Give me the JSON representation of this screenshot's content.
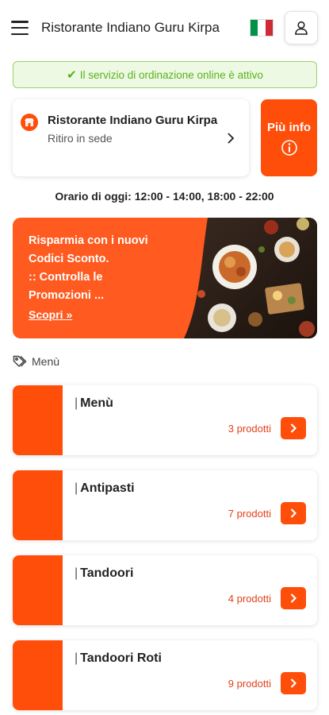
{
  "header": {
    "title": "Ristorante Indiano Guru Kirpa",
    "language_flag": "italy-flag",
    "user_icon": "user-icon"
  },
  "status": {
    "text": "Il servizio di ordinazione online è attivo",
    "color": "#57b21f"
  },
  "restaurant": {
    "name": "Ristorante Indiano Guru Kirpa",
    "mode": "Ritiro in sede"
  },
  "info_button": {
    "label": "Più info"
  },
  "hours": {
    "text": "Orario di oggi: 12:00 - 14:00, 18:00 - 22:00"
  },
  "promo": {
    "line1": "Risparmia con i nuovi",
    "line2": "Codici Sconto.",
    "line3": ":: Controlla le",
    "line4": "Promozioni ...",
    "link": "Scopri",
    "link_icon": "double-chevron-right-icon"
  },
  "section": {
    "label": "Menù",
    "icon": "tag-icon"
  },
  "categories": [
    {
      "name": "Menù",
      "count": "3 prodotti"
    },
    {
      "name": "Antipasti",
      "count": "7 prodotti"
    },
    {
      "name": "Tandoori",
      "count": "4 prodotti"
    },
    {
      "name": "Tandoori Roti",
      "count": "9 prodotti"
    }
  ],
  "colors": {
    "accent": "#ff4d0a",
    "count_text": "#e2411a",
    "banner_bg": "#eef9e3",
    "banner_border": "#9bd36a"
  }
}
